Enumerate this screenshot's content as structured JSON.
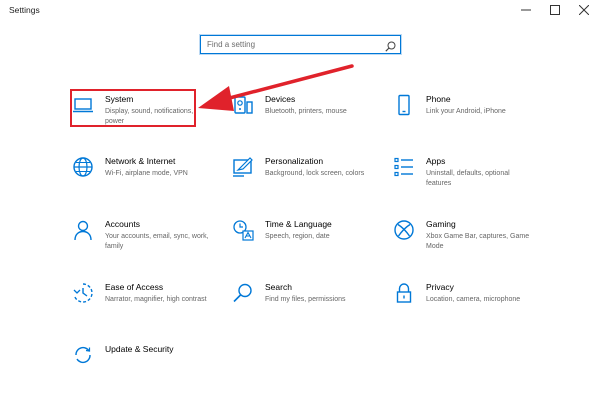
{
  "window": {
    "title": "Settings",
    "minimize_icon": "minimize-icon",
    "maximize_icon": "maximize-icon",
    "close_icon": "close-icon"
  },
  "search": {
    "placeholder": "Find a setting",
    "icon": "search-icon"
  },
  "colors": {
    "accent": "#0078d7",
    "highlight": "#e0222b"
  },
  "tiles": [
    {
      "name": "System",
      "desc": "Display, sound, notifications, power",
      "icon": "laptop-icon"
    },
    {
      "name": "Devices",
      "desc": "Bluetooth, printers, mouse",
      "icon": "devices-icon"
    },
    {
      "name": "Phone",
      "desc": "Link your Android, iPhone",
      "icon": "phone-icon"
    },
    {
      "name": "Network & Internet",
      "desc": "Wi-Fi, airplane mode, VPN",
      "icon": "globe-icon"
    },
    {
      "name": "Personalization",
      "desc": "Background, lock screen, colors",
      "icon": "personalization-icon"
    },
    {
      "name": "Apps",
      "desc": "Uninstall, defaults, optional features",
      "icon": "apps-list-icon"
    },
    {
      "name": "Accounts",
      "desc": "Your accounts, email, sync, work, family",
      "icon": "person-icon"
    },
    {
      "name": "Time & Language",
      "desc": "Speech, region, date",
      "icon": "time-language-icon"
    },
    {
      "name": "Gaming",
      "desc": "Xbox Game Bar, captures, Game Mode",
      "icon": "xbox-icon"
    },
    {
      "name": "Ease of Access",
      "desc": "Narrator, magnifier, high contrast",
      "icon": "ease-of-access-icon"
    },
    {
      "name": "Search",
      "desc": "Find my files, permissions",
      "icon": "search-icon"
    },
    {
      "name": "Privacy",
      "desc": "Location, camera, microphone",
      "icon": "lock-icon"
    },
    {
      "name": "Update & Security",
      "desc": "",
      "icon": "update-icon"
    }
  ]
}
